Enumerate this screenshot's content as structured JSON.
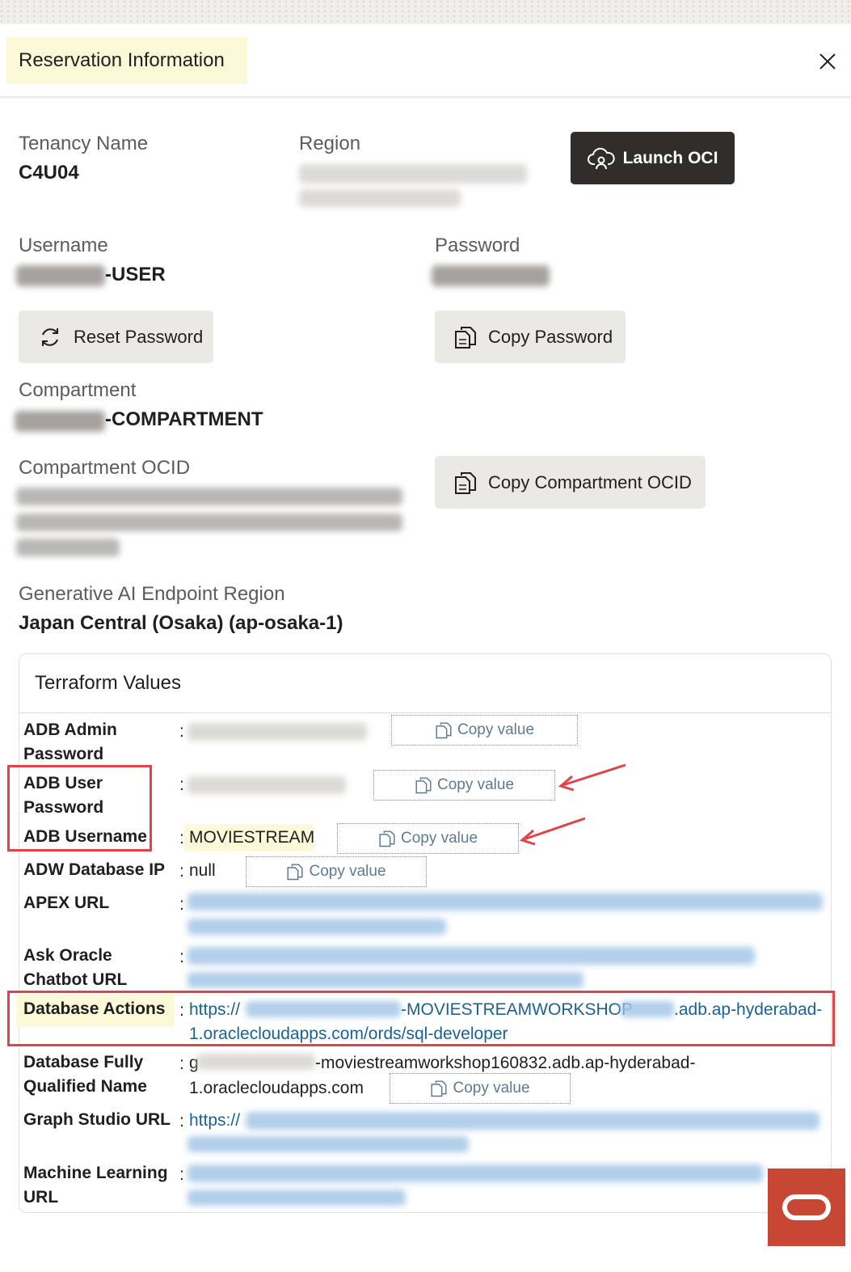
{
  "dialog": {
    "title": "Reservation Information"
  },
  "tenancy": {
    "label": "Tenancy Name",
    "value": "C4U04"
  },
  "region": {
    "label": "Region"
  },
  "launch_oci": {
    "label": "Launch OCI"
  },
  "username": {
    "label": "Username",
    "suffix": "-USER"
  },
  "password": {
    "label": "Password"
  },
  "reset_password": {
    "label": "Reset Password"
  },
  "copy_password": {
    "label": "Copy Password"
  },
  "compartment": {
    "label": "Compartment",
    "suffix": "-COMPARTMENT"
  },
  "compartment_ocid": {
    "label": "Compartment OCID"
  },
  "copy_compartment_ocid": {
    "label": "Copy Compartment OCID"
  },
  "genai_region": {
    "label": "Generative AI Endpoint Region",
    "value": "Japan Central (Osaka) (ap-osaka-1)"
  },
  "terraform": {
    "title": "Terraform Values",
    "copy_value_label": "Copy value",
    "colon": ":",
    "rows": {
      "adb_admin_password": {
        "label": "ADB Admin Password"
      },
      "adb_user_password": {
        "label": "ADB User Password"
      },
      "adb_username": {
        "label": "ADB Username",
        "value": "MOVIESTREAM"
      },
      "adw_database_ip": {
        "label": "ADW Database IP",
        "value": "null"
      },
      "apex_url": {
        "label": "APEX URL"
      },
      "ask_oracle_chatbot_url": {
        "label": "Ask Oracle Chatbot URL"
      },
      "database_actions": {
        "label": "Database Actions",
        "value_prefix": "https://",
        "value_mid": "-MOVIESTREAMWORKSHOP",
        "value_tail": ".adb.ap-hyderabad-",
        "value_line2": "1.oraclecloudapps.com/ords/sql-developer"
      },
      "db_fqn": {
        "label": "Database Fully Qualified Name",
        "value_prefix": "g",
        "value_tail": "-moviestreamworkshop160832.adb.ap-hyderabad-",
        "value_line2": "1.oraclecloudapps.com"
      },
      "graph_studio_url": {
        "label": "Graph Studio URL",
        "value_prefix": "https://"
      },
      "machine_learning_url": {
        "label": "Machine Learning URL"
      }
    }
  },
  "colors": {
    "accent_dark": "#312d2a",
    "highlight": "#fbf9d8",
    "annotation_red": "#e0444a",
    "link": "#1b6196",
    "oracle_red": "#c74634"
  },
  "icons": [
    "close-icon",
    "cloud-user-icon",
    "refresh-icon",
    "copy-icon",
    "oracle-logo-icon"
  ]
}
